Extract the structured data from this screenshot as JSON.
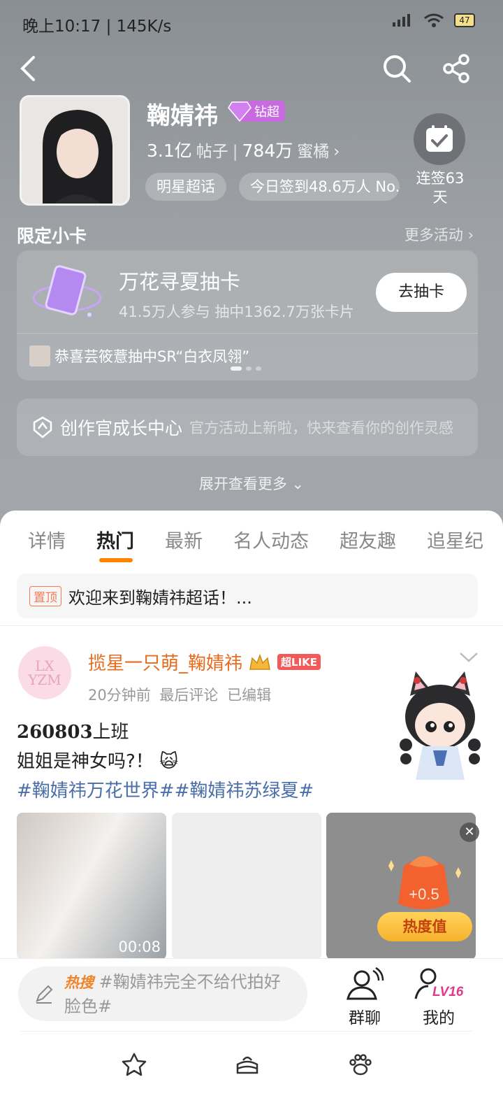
{
  "status_bar": {
    "time": "晚上10:17 | 145K/s",
    "battery": "47"
  },
  "profile": {
    "name": "鞠婧祎",
    "badge": "钻超",
    "posts_count": "3.1亿",
    "posts_label": "帖子",
    "fans_count": "784万",
    "fans_label": "蜜橘",
    "tag_category": "明星超话",
    "tag_checkin": "今日签到48.6万人 No.",
    "checkin_streak": "连签63天"
  },
  "limited_card": {
    "section_title": "限定小卡",
    "more_label": "更多活动",
    "card_title": "万花寻夏抽卡",
    "card_sub": "41.5万人参与 抽中1362.7万张卡片",
    "draw_button": "去抽卡",
    "ticker": "恭喜芸筱薏抽中SR“白衣凤翎”"
  },
  "growth": {
    "title": "创作官成长中心",
    "subtitle": "官方活动上新啦，快来查看你的创作灵感"
  },
  "expand_label": "展开查看更多",
  "tabs": [
    "详情",
    "热门",
    "最新",
    "名人动态",
    "超友趣",
    "追星纪"
  ],
  "active_tab": "热门",
  "pinned": {
    "tag": "置顶",
    "text": "欢迎来到鞠婧祎超话！..."
  },
  "post": {
    "avatar_text": "LX YZM",
    "user": "揽星一只萌_鞠婧祎",
    "like_tag": "超LIKE",
    "meta": "20分钟前 最后评论 已编辑",
    "line1_bold": "260803",
    "line1_rest": "上班",
    "line2": "姐姐是神女吗?！",
    "tags": "#鞠婧祎万花世界##鞠婧祎苏绿夏#",
    "video_duration": "00:08"
  },
  "float_widget": {
    "bag_value": "+0.5",
    "button": "热度值"
  },
  "bottom": {
    "hot_label": "热搜",
    "search_text": "#鞠婧祎完全不给代拍好脸色#",
    "group_chat": "群聊",
    "mine": "我的",
    "level": "LV16"
  }
}
